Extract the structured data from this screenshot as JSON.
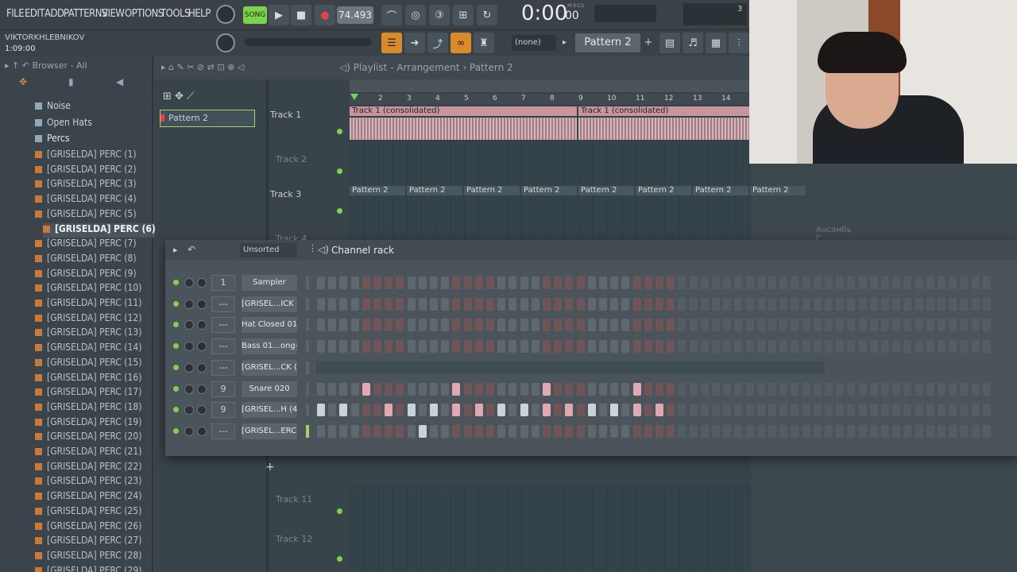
{
  "menu": [
    "FILE",
    "EDIT",
    "ADD",
    "PATTERNS",
    "VIEW",
    "OPTIONS",
    "TOOLS",
    "HELP"
  ],
  "transport": {
    "mode": "SONG",
    "tempo": "74.493",
    "time": "0:00",
    "time_small": "00",
    "time_label": "M:S:CS",
    "numerator": "3"
  },
  "user": {
    "name": "VIKTORKHLEBNIKOV",
    "time": "1:09:00"
  },
  "pattern_selector": {
    "none": "(none)",
    "current": "Pattern 2"
  },
  "browser": {
    "title": "Browser - All",
    "folders": [
      "Noise",
      "Open Hats",
      "Percs"
    ],
    "items": [
      "[GRISELDA] PERC (1)",
      "[GRISELDA] PERC (2)",
      "[GRISELDA] PERC (3)",
      "[GRISELDA] PERC (4)",
      "[GRISELDA] PERC (5)",
      "[GRISELDA] PERC (6)",
      "[GRISELDA] PERC (7)",
      "[GRISELDA] PERC (8)",
      "[GRISELDA] PERC (9)",
      "[GRISELDA] PERC (10)",
      "[GRISELDA] PERC (11)",
      "[GRISELDA] PERC (12)",
      "[GRISELDA] PERC (13)",
      "[GRISELDA] PERC (14)",
      "[GRISELDA] PERC (15)",
      "[GRISELDA] PERC (16)",
      "[GRISELDA] PERC (17)",
      "[GRISELDA] PERC (18)",
      "[GRISELDA] PERC (19)",
      "[GRISELDA] PERC (20)",
      "[GRISELDA] PERC (21)",
      "[GRISELDA] PERC (22)",
      "[GRISELDA] PERC (23)",
      "[GRISELDA] PERC (24)",
      "[GRISELDA] PERC (25)",
      "[GRISELDA] PERC (26)",
      "[GRISELDA] PERC (27)",
      "[GRISELDA] PERC (28)",
      "[GRISELDA] PERC (29)"
    ]
  },
  "playlist": {
    "title": "Playlist - Arrangement",
    "pattern": "Pattern 2",
    "pattern_item": "Pattern 2",
    "bars": [
      "2",
      "3",
      "4",
      "5",
      "6",
      "7",
      "8",
      "9",
      "10",
      "11",
      "12",
      "13",
      "14"
    ],
    "tracks": [
      "Track 1",
      "Track 2",
      "Track 3",
      "Track 4",
      "Track 11",
      "Track 12"
    ],
    "clip_audio": "Track 1 (consolidated)",
    "clip_pattern": "Pattern 2",
    "ghost": "Ансамбь Г... Лачин #2"
  },
  "rack": {
    "title": "Channel rack",
    "filter": "Unsorted",
    "channels": [
      {
        "num": "1",
        "name": "Sampler",
        "steps": []
      },
      {
        "num": "---",
        "name": "[GRISEL...ICK (1)",
        "steps": []
      },
      {
        "num": "---",
        "name": "Hat Closed 017",
        "steps": []
      },
      {
        "num": "---",
        "name": "Bass 01...ong-St",
        "steps": []
      },
      {
        "num": "---",
        "name": "[GRISEL...CK (15)",
        "steps": []
      },
      {
        "num": "9",
        "name": "Snare 020",
        "steps": [
          4,
          12,
          20,
          28
        ]
      },
      {
        "num": "9",
        "name": "[GRISEL...H (42)",
        "steps": [
          0,
          2,
          6,
          8,
          10,
          12,
          14,
          16,
          18,
          20,
          22,
          24,
          26,
          28,
          30
        ]
      },
      {
        "num": "---",
        "name": "[GRISEL...ERC (6)",
        "steps": [
          9
        ]
      }
    ]
  },
  "colors": {
    "accent": "#d98a2b",
    "green": "#7bd34a",
    "clip_audio": "#c9949c",
    "clip_pattern": "#8a9aa3"
  }
}
